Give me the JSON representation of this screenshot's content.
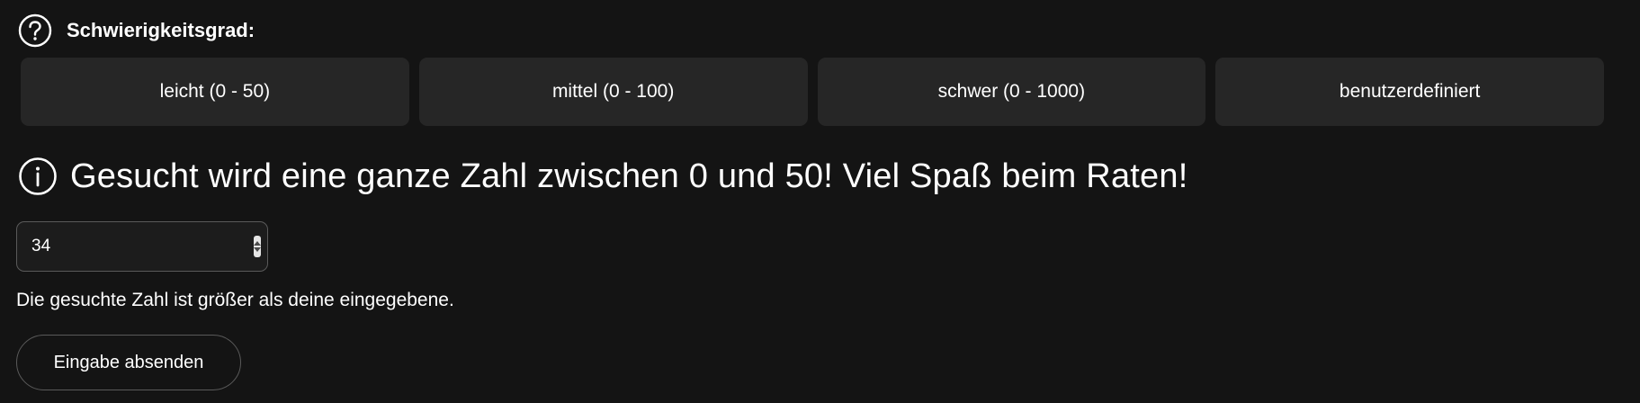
{
  "difficulty": {
    "label": "Schwierigkeitsgrad:",
    "icon": "question-circle-icon",
    "options": [
      {
        "label": "leicht (0 - 50)"
      },
      {
        "label": "mittel (0 - 100)"
      },
      {
        "label": "schwer (0 - 1000)"
      },
      {
        "label": "benutzerdefiniert"
      }
    ]
  },
  "info": {
    "icon": "info-circle-icon",
    "text": "Gesucht wird eine ganze Zahl zwischen 0 und 50! Viel Spaß beim Raten!"
  },
  "guess": {
    "value": "34"
  },
  "feedback": {
    "text": "Die gesuchte Zahl ist größer als deine eingegebene."
  },
  "submit": {
    "label": "Eingabe absenden"
  },
  "colors": {
    "background": "#141414",
    "button_bg": "#262626",
    "border": "#5a5a5a",
    "text": "#ffffff"
  }
}
